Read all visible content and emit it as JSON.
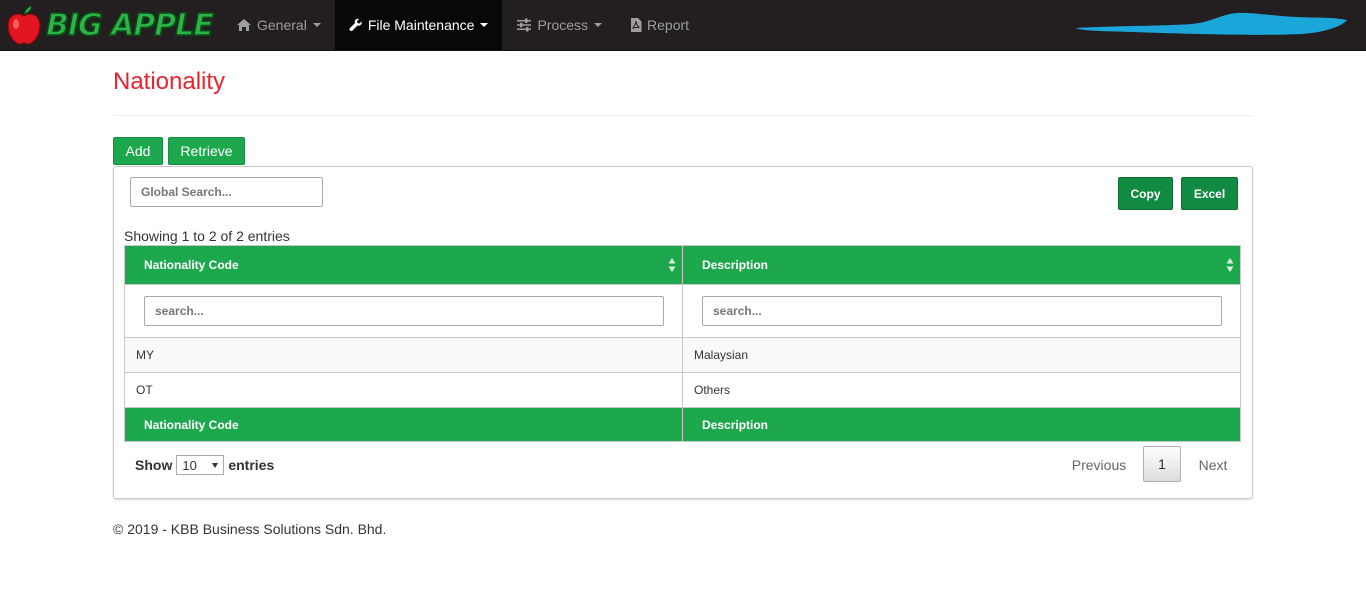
{
  "brand": {
    "name": "BIG APPLE",
    "logo_icon": "apple-icon"
  },
  "nav": {
    "items": [
      {
        "label": "General",
        "icon": "home-icon",
        "dropdown": true,
        "active": false
      },
      {
        "label": "File Maintenance",
        "icon": "wrench-icon",
        "dropdown": true,
        "active": true
      },
      {
        "label": "Process",
        "icon": "sliders-icon",
        "dropdown": true,
        "active": false
      },
      {
        "label": "Report",
        "icon": "pdf-file-icon",
        "dropdown": false,
        "active": false
      }
    ]
  },
  "page": {
    "title": "Nationality"
  },
  "actions": {
    "add_label": "Add",
    "retrieve_label": "Retrieve"
  },
  "toolbar": {
    "global_search_placeholder": "Global Search...",
    "copy_label": "Copy",
    "excel_label": "Excel"
  },
  "table": {
    "info": "Showing 1 to 2 of 2 entries",
    "columns": [
      "Nationality Code",
      "Description"
    ],
    "filter_placeholder": "search...",
    "rows": [
      {
        "code": "MY",
        "description": "Malaysian"
      },
      {
        "code": "OT",
        "description": "Others"
      }
    ],
    "footer_columns": [
      "Nationality Code",
      "Description"
    ]
  },
  "length": {
    "show_label": "Show",
    "selected": "10",
    "entries_label": "entries"
  },
  "pagination": {
    "previous": "Previous",
    "current": "1",
    "next": "Next"
  },
  "footer": {
    "text": "© 2019 - KBB Business Solutions Sdn. Bhd."
  },
  "colors": {
    "accent_green": "#1ea84e",
    "title_red": "#e8232e",
    "navbar": "#231f20"
  }
}
